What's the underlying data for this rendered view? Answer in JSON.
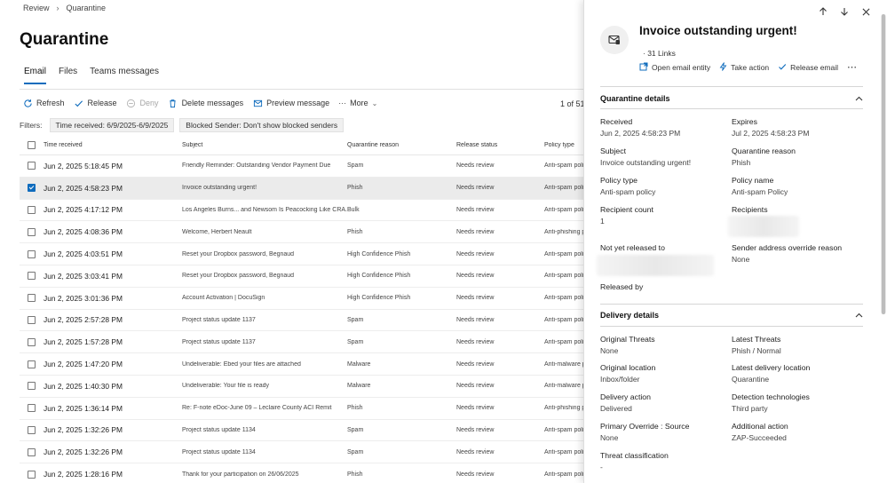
{
  "breadcrumb": [
    "Review",
    "Quarantine"
  ],
  "page_title": "Quarantine",
  "tabs": [
    {
      "label": "Email",
      "active": true
    },
    {
      "label": "Files",
      "active": false
    },
    {
      "label": "Teams messages",
      "active": false
    }
  ],
  "toolbar": {
    "refresh": "Refresh",
    "release": "Release",
    "deny": "Deny",
    "delete": "Delete messages",
    "preview": "Preview message",
    "more": "More"
  },
  "pager": "1 of 51",
  "filters": {
    "label": "Filters:",
    "chips": [
      "Time received: 6/9/2025-6/9/2025",
      "Blocked Sender: Don't show blocked senders"
    ]
  },
  "table": {
    "headers": [
      "Time received",
      "Subject",
      "Quarantine reason",
      "Release status",
      "Policy type"
    ],
    "rows": [
      {
        "time": "Jun 2, 2025 5:18:45 PM",
        "subject": "Friendly Reminder: Outstanding Vendor Payment Due",
        "reason": "Spam",
        "status": "Needs review",
        "policy": "Anti-spam policy",
        "selected": false
      },
      {
        "time": "Jun 2, 2025 4:58:23 PM",
        "subject": "Invoice outstanding urgent!",
        "reason": "Phish",
        "status": "Needs review",
        "policy": "Anti-spam policy",
        "selected": true
      },
      {
        "time": "Jun 2, 2025 4:17:12 PM",
        "subject": "Los Angeles Burns... and Newsom Is Peacocking Like CRA...",
        "reason": "Bulk",
        "status": "Needs review",
        "policy": "Anti-spam policy",
        "selected": false
      },
      {
        "time": "Jun 2, 2025 4:08:36 PM",
        "subject": "Welcome, Herbert Neault",
        "reason": "Phish",
        "status": "Needs review",
        "policy": "Anti-phishing policy",
        "selected": false
      },
      {
        "time": "Jun 2, 2025 4:03:51 PM",
        "subject": "Reset your Dropbox password, Begnaud",
        "reason": "High Confidence Phish",
        "status": "Needs review",
        "policy": "Anti-spam policy",
        "selected": false
      },
      {
        "time": "Jun 2, 2025 3:03:41 PM",
        "subject": "Reset your Dropbox password, Begnaud",
        "reason": "High Confidence Phish",
        "status": "Needs review",
        "policy": "Anti-spam policy",
        "selected": false
      },
      {
        "time": "Jun 2, 2025 3:01:36 PM",
        "subject": "Account Activation | DocuSign",
        "reason": "High Confidence Phish",
        "status": "Needs review",
        "policy": "Anti-spam policy",
        "selected": false
      },
      {
        "time": "Jun 2, 2025 2:57:28 PM",
        "subject": "Project status update 1137",
        "reason": "Spam",
        "status": "Needs review",
        "policy": "Anti-spam policy",
        "selected": false
      },
      {
        "time": "Jun 2, 2025 1:57:28 PM",
        "subject": "Project status update 1137",
        "reason": "Spam",
        "status": "Needs review",
        "policy": "Anti-spam policy",
        "selected": false
      },
      {
        "time": "Jun 2, 2025 1:47:20 PM",
        "subject": "Undeliverable: Ebed your files are attached",
        "reason": "Malware",
        "status": "Needs review",
        "policy": "Anti-malware policy",
        "selected": false
      },
      {
        "time": "Jun 2, 2025 1:40:30 PM",
        "subject": "Undeliverable: Your file is ready",
        "reason": "Malware",
        "status": "Needs review",
        "policy": "Anti-malware policy",
        "selected": false
      },
      {
        "time": "Jun 2, 2025 1:36:14 PM",
        "subject": "Re: F-note eDoc-June 09 – Leclaire County ACI Remit",
        "reason": "Phish",
        "status": "Needs review",
        "policy": "Anti-phishing policy",
        "selected": false
      },
      {
        "time": "Jun 2, 2025 1:32:26 PM",
        "subject": "Project status update 1134",
        "reason": "Spam",
        "status": "Needs review",
        "policy": "Anti-spam policy",
        "selected": false
      },
      {
        "time": "Jun 2, 2025 1:32:26 PM",
        "subject": "Project status update 1134",
        "reason": "Spam",
        "status": "Needs review",
        "policy": "Anti-spam policy",
        "selected": false
      },
      {
        "time": "Jun 2, 2025 1:28:16 PM",
        "subject": "Thank for your participation on 26/06/2025",
        "reason": "Phish",
        "status": "Needs review",
        "policy": "Anti-spam policy",
        "selected": false
      }
    ]
  },
  "panel": {
    "title": "Invoice outstanding urgent!",
    "links": "· 31 Links",
    "actions": {
      "open_entity": "Open email entity",
      "take_action": "Take action",
      "release": "Release email"
    },
    "quarantine_details": {
      "header": "Quarantine details",
      "received_label": "Received",
      "received_value": "Jun 2, 2025 4:58:23 PM",
      "expires_label": "Expires",
      "expires_value": "Jul 2, 2025 4:58:23 PM",
      "subject_label": "Subject",
      "subject_value": "Invoice outstanding urgent!",
      "reason_label": "Quarantine reason",
      "reason_value": "Phish",
      "policy_type_label": "Policy type",
      "policy_type_value": "Anti-spam policy",
      "policy_name_label": "Policy name",
      "policy_name_value": "Anti-spam Policy",
      "recipient_count_label": "Recipient count",
      "recipient_count_value": "1",
      "recipients_label": "Recipients",
      "not_released_label": "Not yet released to",
      "sender_override_label": "Sender address override reason",
      "sender_override_value": "None",
      "released_by_label": "Released by"
    },
    "delivery_details": {
      "header": "Delivery details",
      "original_threats_label": "Original Threats",
      "original_threats_value": "None",
      "latest_threats_label": "Latest Threats",
      "latest_threats_value": "Phish / Normal",
      "original_location_label": "Original location",
      "original_location_value": "Inbox/folder",
      "latest_location_label": "Latest delivery location",
      "latest_location_value": "Quarantine",
      "delivery_action_label": "Delivery action",
      "delivery_action_value": "Delivered",
      "detection_label": "Detection technologies",
      "detection_value": "Third party",
      "primary_override_label": "Primary Override : Source",
      "primary_override_value": "None",
      "additional_action_label": "Additional action",
      "additional_action_value": "ZAP-Succeeded",
      "threat_class_label": "Threat classification",
      "threat_class_value": "-"
    }
  },
  "colors": {
    "accent": "#0f6cbd",
    "selected_row": "#ebebeb"
  }
}
